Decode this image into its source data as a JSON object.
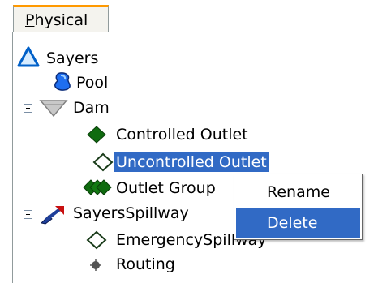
{
  "tabs": [
    {
      "label_first": "P",
      "label_rest": "hysical"
    }
  ],
  "tree": {
    "root": "Sayers",
    "pool": "Pool",
    "dam": "Dam",
    "controlled_outlet": "Controlled Outlet",
    "uncontrolled_outlet": "Uncontrolled Outlet",
    "outlet_group": "Outlet Group",
    "spillway": "SayersSpillway",
    "emergency_spillway": "EmergencySpillway",
    "routing": "Routing"
  },
  "context_menu": {
    "items": [
      "Rename",
      "Delete"
    ]
  },
  "colors": {
    "selection": "#316ac5",
    "tab_accent": "#ff9900"
  }
}
